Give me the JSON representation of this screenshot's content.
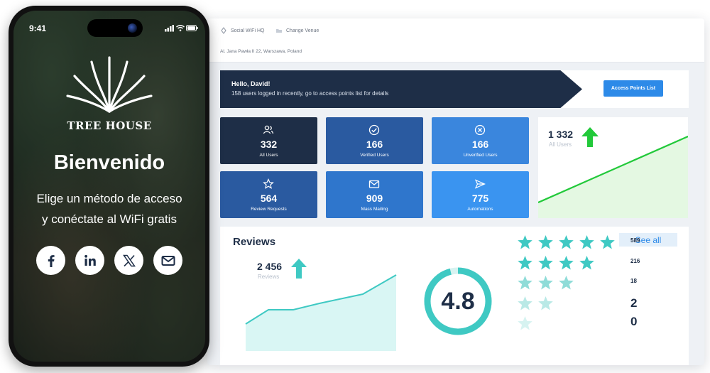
{
  "dashboard": {
    "nav": {
      "hq": "Social WiFi HQ",
      "change_venue": "Change Venue"
    },
    "address": "Al. Jana Pawła II 22, Warszawa, Poland",
    "greeting": {
      "title": "Hello, David!",
      "subtitle": "158 users logged in recently, go to access points list for details",
      "button": "Access Points List"
    },
    "tiles": [
      {
        "value": "332",
        "label": "All Users",
        "icon": "users-icon",
        "color": "#1e2e47"
      },
      {
        "value": "166",
        "label": "Verified Users",
        "icon": "check-circle-icon",
        "color": "#2a5aa0"
      },
      {
        "value": "166",
        "label": "Unverified Users",
        "icon": "x-circle-icon",
        "color": "#3a86dd"
      },
      {
        "value": "564",
        "label": "Review Requests",
        "icon": "star-icon",
        "color": "#2a5aa0"
      },
      {
        "value": "909",
        "label": "Mass Mailing",
        "icon": "mail-icon",
        "color": "#2f76cc"
      },
      {
        "value": "775",
        "label": "Automations",
        "icon": "send-icon",
        "color": "#3a94f0"
      }
    ],
    "all_users_card": {
      "value": "1 332",
      "label": "All Users",
      "trend": "up",
      "accent": "#22c93a"
    },
    "reviews": {
      "title": "Reviews",
      "see_all": "See all",
      "total": "2 456",
      "total_label": "Reviews",
      "trend": "up",
      "accent": "#3fc9c3",
      "rating": "4.8",
      "rating_fraction": 0.96,
      "breakdown": [
        {
          "stars": 5,
          "count": "589"
        },
        {
          "stars": 4,
          "count": "216"
        },
        {
          "stars": 3,
          "count": "18"
        },
        {
          "stars": 2,
          "count": "2"
        },
        {
          "stars": 1,
          "count": "0"
        }
      ]
    }
  },
  "phone": {
    "time": "9:41",
    "brand": "TREE HOUSE",
    "welcome": "Bienvenido",
    "line1": "Elige un método de acceso",
    "line2": "y conéctate al WiFi gratis",
    "social": [
      "facebook-icon",
      "linkedin-icon",
      "x-icon",
      "mail-icon"
    ]
  }
}
